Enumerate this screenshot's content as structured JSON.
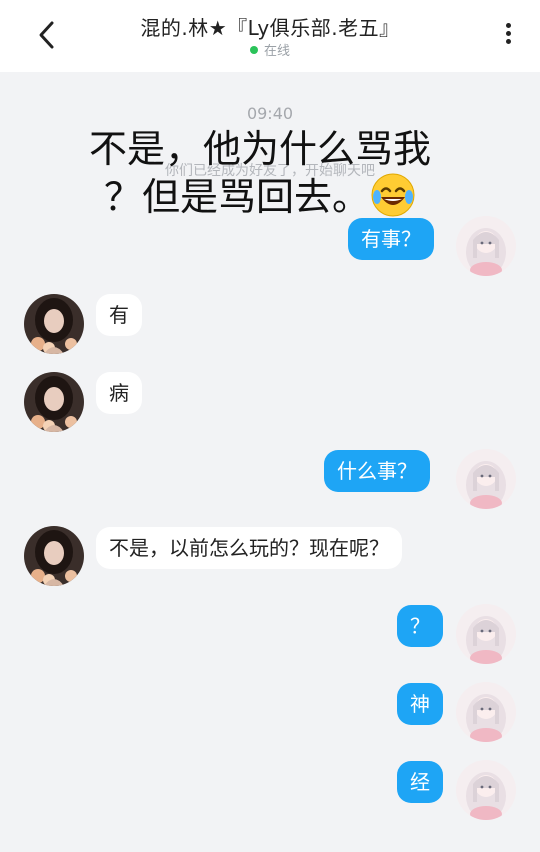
{
  "header": {
    "title": "混的.林★『Ly俱乐部.老五』",
    "status": "在线",
    "back_icon": "chevron-left-icon",
    "more_icon": "more-vertical-icon"
  },
  "chat": {
    "timestamp": "09:40",
    "system_note": "你们已经成为好友了，开始聊天吧",
    "caption_line1": "不是，他为什么骂我",
    "caption_line2": "？但是骂回去。",
    "caption_emoji": "laughing-tears-emoji",
    "messages": [
      {
        "side": "out",
        "text": "有事？"
      },
      {
        "side": "in",
        "text": "有"
      },
      {
        "side": "in",
        "text": "病"
      },
      {
        "side": "out",
        "text": "什么事？"
      },
      {
        "side": "in",
        "text": "不是，以前怎么玩的？现在呢？"
      },
      {
        "side": "out",
        "text": "？"
      },
      {
        "side": "out",
        "text": "神"
      },
      {
        "side": "out",
        "text": "经"
      }
    ]
  },
  "colors": {
    "accent": "#1ea5f5",
    "online": "#2bc35a",
    "background": "#f2f3f5"
  }
}
